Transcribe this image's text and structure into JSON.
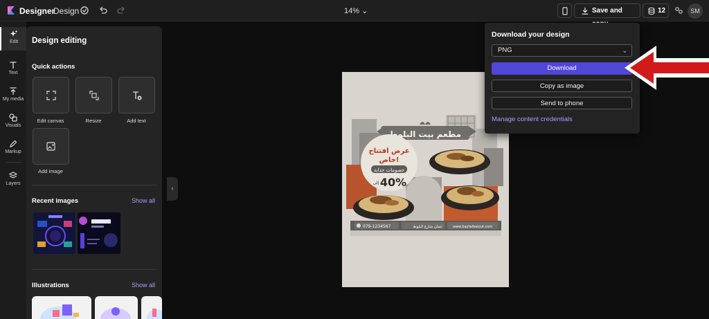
{
  "app": {
    "brand": "Designer",
    "mode": "Design",
    "zoom": "14%",
    "save_label": "Save and copy",
    "credits": "12",
    "user_initials": "SM"
  },
  "rail": [
    {
      "label": "Edit",
      "icon": "sparkle-icon",
      "active": true
    },
    {
      "label": "Text",
      "icon": "text-icon"
    },
    {
      "label": "My media",
      "icon": "upload-icon"
    },
    {
      "label": "Visuals",
      "icon": "shapes-icon"
    },
    {
      "label": "Markup",
      "icon": "pen-icon"
    },
    {
      "label": "Layers",
      "icon": "layers-icon"
    }
  ],
  "panel": {
    "title": "Design editing",
    "quick_actions_title": "Quick actions",
    "quick_actions": [
      "Edit canvas",
      "Resize",
      "Add text",
      "Add image"
    ],
    "recent_images_title": "Recent images",
    "illustrations_title": "Illustrations",
    "show_all": "Show all"
  },
  "poster": {
    "restaurant_name": "مطعم بيت البلوط",
    "offer_line1": "عرض افتتاح",
    "offer_line2": "خاص!",
    "offer_line3": "خصومات جذابة",
    "discount": "40%",
    "discount_prefix": "إلى",
    "phone": "079-1234567",
    "address": "عمان شارع البلوط",
    "website": "www.baytalbalout.com"
  },
  "download_panel": {
    "title": "Download your design",
    "format": "PNG",
    "download_label": "Download",
    "copy_label": "Copy as image",
    "send_label": "Send to phone",
    "credentials_link": "Manage content credentials"
  },
  "colors": {
    "accent": "#5146d6",
    "link": "#a99cff",
    "arrow": "#d11b1b"
  }
}
